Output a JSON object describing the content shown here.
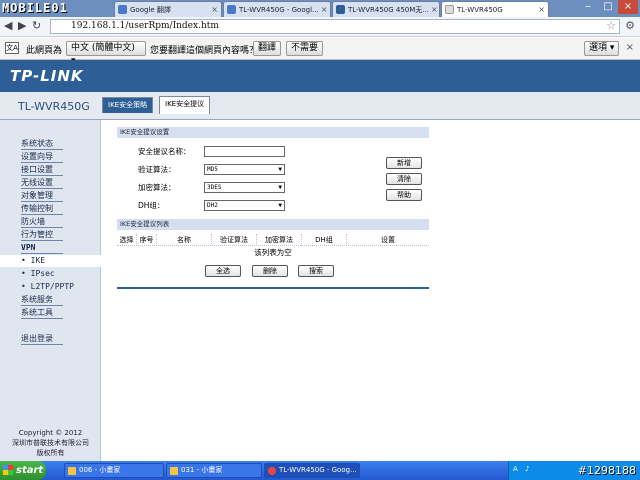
{
  "browser": {
    "tabs": [
      {
        "label": "Google 翻譯"
      },
      {
        "label": "TL-WVR450G - Googl..."
      },
      {
        "label": "TL-WVR450G 450M无..."
      },
      {
        "label": "TL-WVR450G"
      }
    ],
    "url": "192.168.1.1/userRpm/Index.htm",
    "logo_text": "MOBILE01"
  },
  "translate_bar": {
    "prefix": "此網頁為",
    "language": "中文 (簡體中文)",
    "question": "您要翻譯這個網頁內容嗎？",
    "translate_button": "翻譯",
    "no_button": "不需要",
    "options_button": "選項"
  },
  "router": {
    "brand": "TP-LINK",
    "model": "TL-WVR450G",
    "tabs": [
      {
        "label": "IKE安全策略"
      },
      {
        "label": "IKE安全提议"
      }
    ]
  },
  "sidebar": {
    "items": [
      {
        "label": "系统状态"
      },
      {
        "label": "设置向导"
      },
      {
        "label": "接口设置"
      },
      {
        "label": "无线设置"
      },
      {
        "label": "对象管理"
      },
      {
        "label": "传输控制"
      },
      {
        "label": "防火墙"
      },
      {
        "label": "行为管控"
      },
      {
        "label": "VPN"
      },
      {
        "label": "• IKE"
      },
      {
        "label": "• IPsec"
      },
      {
        "label": "• L2TP/PPTP"
      },
      {
        "label": "系统服务"
      },
      {
        "label": "系统工具"
      },
      {
        "label": "退出登录"
      }
    ],
    "copyright": [
      "Copyright © 2012",
      "深圳市普联技术有限公司",
      "版权所有"
    ]
  },
  "settings": {
    "header": "IKE安全提议设置",
    "name_label": "安全提议名称：",
    "name_value": "",
    "auth_label": "验证算法：",
    "auth_value": "MD5",
    "enc_label": "加密算法：",
    "enc_value": "3DES",
    "dh_label": "DH组：",
    "dh_value": "DH2",
    "add_button": "新增",
    "clear_button": "清除",
    "help_button": "帮助"
  },
  "list": {
    "header": "IKE安全提议列表",
    "columns": [
      "选择",
      "序号",
      "名称",
      "验证算法",
      "加密算法",
      "DH组",
      "设置"
    ],
    "empty_text": "该列表为空",
    "select_all_button": "全选",
    "delete_button": "删除",
    "search_button": "搜索"
  },
  "taskbar": {
    "start": "start",
    "tasks": [
      {
        "label": "006 - 小畫家"
      },
      {
        "label": "031 - 小畫家"
      },
      {
        "label": "TL-WVR450G - Goog..."
      }
    ],
    "watermark": "#1298188"
  }
}
